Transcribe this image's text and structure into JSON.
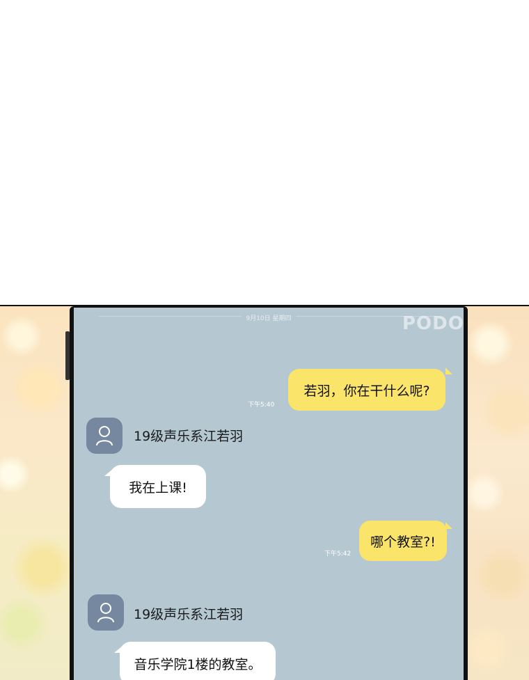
{
  "chat": {
    "date": "9月10日 星期四",
    "watermark": "PODO",
    "messages": [
      {
        "side": "out",
        "text": "若羽，你在干什么呢?",
        "time": "下午5:40"
      },
      {
        "side": "in",
        "sender": "19级声乐系江若羽",
        "text": "我在上课!"
      },
      {
        "side": "out",
        "text": "哪个教室?!",
        "time": "下午5:42"
      },
      {
        "side": "in",
        "sender": "19级声乐系江若羽",
        "text": "音乐学院1楼的教室。"
      }
    ]
  },
  "icons": {
    "avatar": "person-icon"
  },
  "colors": {
    "screen_bg": "#b5c8d2",
    "outgoing_bubble": "#fbe46a",
    "incoming_bubble": "#ffffff",
    "avatar_bg": "#7688a0"
  }
}
